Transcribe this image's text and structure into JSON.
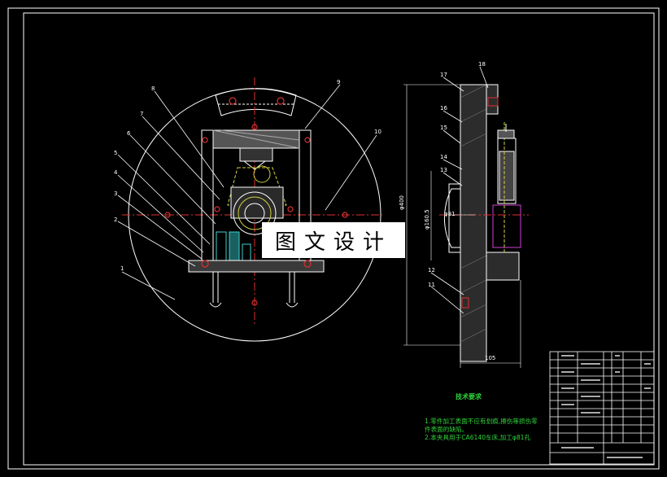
{
  "watermark": "图文设计",
  "notes": {
    "title": "技术要求",
    "line1": "1.零件加工表面不应有划痕,擦伤等损伤零",
    "line1b": "件表面的缺陷。",
    "line2": "2.本夹具用于CA6140车床,加工φ81孔"
  },
  "dimensions": {
    "width_bottom": "105",
    "height_left": "φ400",
    "dia_inner": "φ160.5",
    "dia_small": "φ81"
  },
  "balloons": [
    "1",
    "2",
    "3",
    "4",
    "5",
    "6",
    "7",
    "8",
    "9",
    "10",
    "11",
    "12",
    "13",
    "14",
    "15",
    "16",
    "17",
    "18"
  ],
  "colors": {
    "line": "#ffffff",
    "red": "#e03030",
    "green": "#2fd43a",
    "cyan": "#3fd0d0",
    "magenta": "#d040d0",
    "yellow": "#d0d040"
  }
}
